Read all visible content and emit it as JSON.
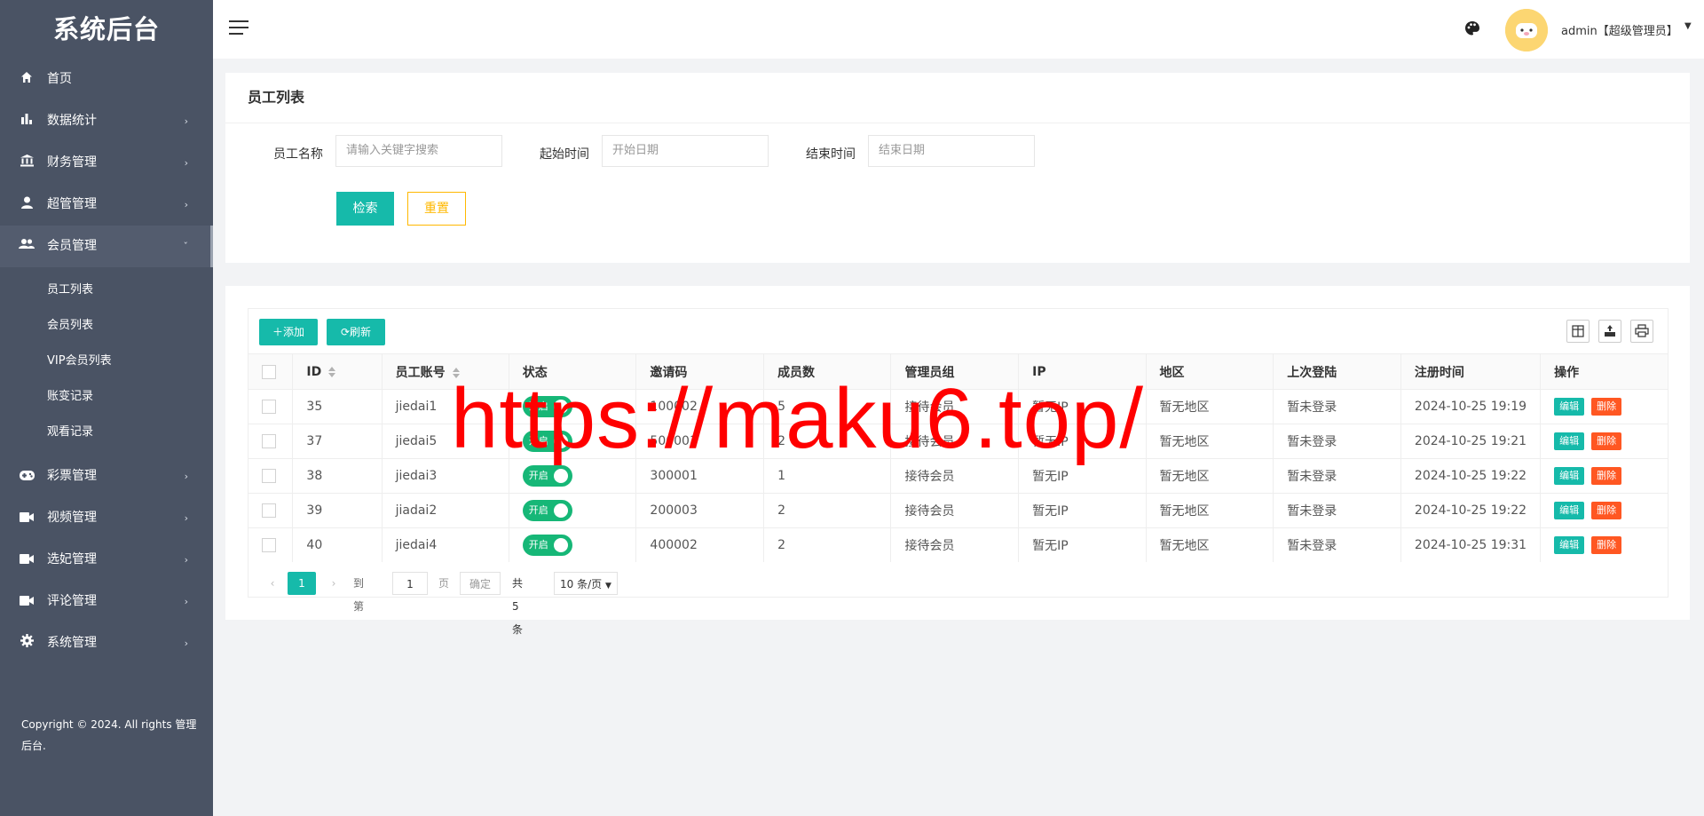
{
  "sidebar": {
    "brand": "系统后台",
    "items": [
      {
        "label": "首页",
        "icon": "home-icon"
      },
      {
        "label": "数据统计",
        "icon": "bar-chart-icon"
      },
      {
        "label": "财务管理",
        "icon": "bank-icon"
      },
      {
        "label": "超管管理",
        "icon": "user-icon"
      },
      {
        "label": "会员管理",
        "icon": "users-icon"
      },
      {
        "label": "彩票管理",
        "icon": "gamepad-icon"
      },
      {
        "label": "视频管理",
        "icon": "video-icon"
      },
      {
        "label": "选妃管理",
        "icon": "video-icon"
      },
      {
        "label": "评论管理",
        "icon": "video-icon"
      },
      {
        "label": "系统管理",
        "icon": "gear-icon"
      }
    ],
    "submenu": [
      "员工列表",
      "会员列表",
      "VIP会员列表",
      "账变记录",
      "观看记录"
    ],
    "copyright_line1": "Copyright © 2024. All rights 管理",
    "copyright_line2": "后台."
  },
  "header": {
    "user": "admin【超级管理员】"
  },
  "search": {
    "title": "员工列表",
    "name_label": "员工名称",
    "name_placeholder": "请输入关键字搜索",
    "start_label": "起始时间",
    "start_placeholder": "开始日期",
    "end_label": "结束时间",
    "end_placeholder": "结束日期",
    "search_button": "检索",
    "reset_button": "重置"
  },
  "toolbar": {
    "add_label": "添加",
    "refresh_label": "刷新"
  },
  "table": {
    "columns": [
      "ID",
      "员工账号",
      "状态",
      "邀请码",
      "成员数",
      "管理员组",
      "IP",
      "地区",
      "上次登陆",
      "注册时间",
      "操作"
    ],
    "rows": [
      {
        "id": "35",
        "account": "jiedai1",
        "status": "开启",
        "invite": "100002",
        "members": "5",
        "group": "接待会员",
        "ip": "暂无IP",
        "region": "暂无地区",
        "last_login": "暂未登录",
        "reg_time": "2024-10-25 19:19"
      },
      {
        "id": "37",
        "account": "jiedai5",
        "status": "开启",
        "invite": "500001",
        "members": "2",
        "group": "接待会员",
        "ip": "暂无IP",
        "region": "暂无地区",
        "last_login": "暂未登录",
        "reg_time": "2024-10-25 19:21"
      },
      {
        "id": "38",
        "account": "jiedai3",
        "status": "开启",
        "invite": "300001",
        "members": "1",
        "group": "接待会员",
        "ip": "暂无IP",
        "region": "暂无地区",
        "last_login": "暂未登录",
        "reg_time": "2024-10-25 19:22"
      },
      {
        "id": "39",
        "account": "jiadai2",
        "status": "开启",
        "invite": "200003",
        "members": "2",
        "group": "接待会员",
        "ip": "暂无IP",
        "region": "暂无地区",
        "last_login": "暂未登录",
        "reg_time": "2024-10-25 19:22"
      },
      {
        "id": "40",
        "account": "jiedai4",
        "status": "开启",
        "invite": "400002",
        "members": "2",
        "group": "接待会员",
        "ip": "暂无IP",
        "region": "暂无地区",
        "last_login": "暂未登录",
        "reg_time": "2024-10-25 19:31"
      }
    ],
    "edit_label": "编辑",
    "delete_label": "删除"
  },
  "pager": {
    "current": "1",
    "goto_label": "到第",
    "goto_value": "1",
    "page_unit": "页",
    "confirm": "确定",
    "total": "共 5 条",
    "per_page": "10 条/页"
  },
  "watermark": "https://maku6.top/",
  "colors": {
    "sidebar": "#4a5364",
    "primary": "#16baaa",
    "warning": "#ffb800",
    "danger": "#ff5722",
    "switch_on": "#16b777"
  }
}
